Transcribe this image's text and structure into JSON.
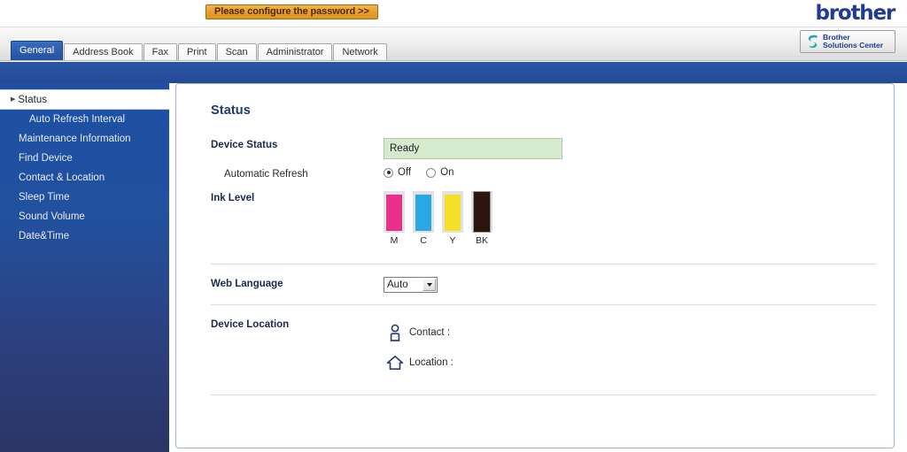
{
  "header": {
    "password_banner": "Please configure the password >>",
    "brand_logo_text": "brother",
    "brand_color": "#1f3a93"
  },
  "tabs": [
    {
      "label": "General",
      "active": true
    },
    {
      "label": "Address Book",
      "active": false
    },
    {
      "label": "Fax",
      "active": false
    },
    {
      "label": "Print",
      "active": false
    },
    {
      "label": "Scan",
      "active": false
    },
    {
      "label": "Administrator",
      "active": false
    },
    {
      "label": "Network",
      "active": false
    }
  ],
  "solutions_button": {
    "line1": "Brother",
    "line2": "Solutions Center",
    "icon": "brother-s-swoosh-icon",
    "icon_color": "#2aa8b0"
  },
  "sidebar": {
    "items": [
      {
        "label": "Status",
        "active": true,
        "sub": false
      },
      {
        "label": "Auto Refresh Interval",
        "active": false,
        "sub": true
      },
      {
        "label": "Maintenance Information",
        "active": false,
        "sub": false
      },
      {
        "label": "Find Device",
        "active": false,
        "sub": false
      },
      {
        "label": "Contact & Location",
        "active": false,
        "sub": false
      },
      {
        "label": "Sleep Time",
        "active": false,
        "sub": false
      },
      {
        "label": "Sound Volume",
        "active": false,
        "sub": false
      },
      {
        "label": "Date&Time",
        "active": false,
        "sub": false
      }
    ]
  },
  "main": {
    "title": "Status",
    "device_status": {
      "label": "Device Status",
      "value": "Ready",
      "box_color": "#d6eace"
    },
    "automatic_refresh": {
      "label": "Automatic Refresh",
      "options": [
        {
          "label": "Off",
          "selected": true
        },
        {
          "label": "On",
          "selected": false
        }
      ]
    },
    "ink_level": {
      "label": "Ink Level",
      "tanks": [
        {
          "name": "M",
          "color": "#e8308a",
          "level_percent": 92
        },
        {
          "name": "C",
          "color": "#29a9e1",
          "level_percent": 92
        },
        {
          "name": "Y",
          "color": "#f5e028",
          "level_percent": 92
        },
        {
          "name": "BK",
          "color": "#2a1510",
          "level_percent": 100
        }
      ]
    },
    "web_language": {
      "label": "Web Language",
      "value": "Auto",
      "options": [
        "Auto"
      ]
    },
    "device_location": {
      "label": "Device Location",
      "contact": {
        "label": "Contact :",
        "icon": "person-icon",
        "value": ""
      },
      "location": {
        "label": "Location :",
        "icon": "home-icon",
        "value": ""
      },
      "icon_color": "#2e3f72"
    }
  }
}
